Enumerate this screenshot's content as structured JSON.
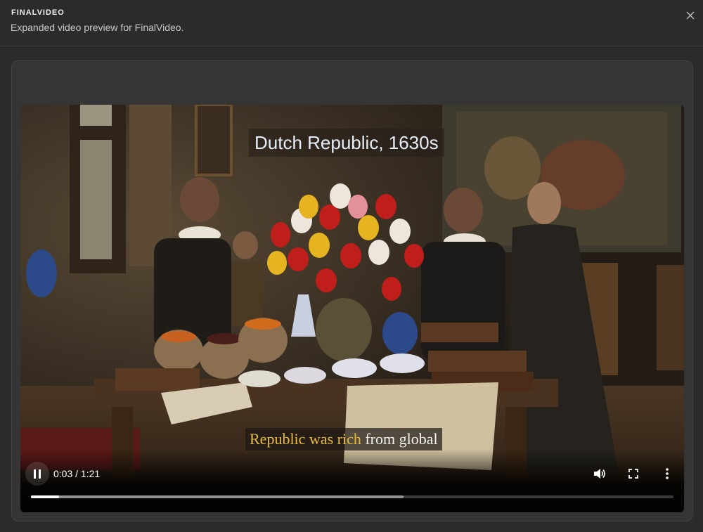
{
  "header": {
    "app_title": "FINALVIDEO",
    "subtitle": "Expanded video preview for FinalVideo."
  },
  "icons": {
    "close": "close-icon",
    "pause": "pause-icon",
    "volume": "volume-icon",
    "fullscreen": "fullscreen-icon",
    "more": "more-vertical-icon"
  },
  "video": {
    "title_caption": "Dutch Republic, 1630s",
    "subtitle_highlighted": "Republic was rich",
    "subtitle_rest": "from global",
    "subtitle_highlight_color": "#e8bd3c",
    "time": "0:03 / 1:21",
    "played_fraction": 0.044,
    "buffered_fraction": 0.58
  }
}
